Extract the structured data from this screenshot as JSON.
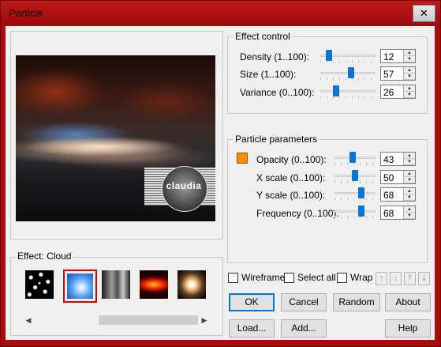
{
  "window": {
    "title": "Particle",
    "close_symbol": "✕"
  },
  "preview": {
    "watermark_text": "claudia"
  },
  "effect": {
    "label": "Effect: Cloud",
    "thumbnails": [
      "stars",
      "cloud",
      "smoke",
      "fire",
      "sparkle"
    ],
    "selected": "cloud"
  },
  "effect_control": {
    "title": "Effect control",
    "rows": [
      {
        "label": "Density (1..100):",
        "value": "12",
        "level": 0.12
      },
      {
        "label": "Size (1..100):",
        "value": "57",
        "level": 0.57
      },
      {
        "label": "Variance (0..100):",
        "value": "26",
        "level": 0.26
      }
    ]
  },
  "particle_parameters": {
    "title": "Particle parameters",
    "swatch_color": "#ff8c00",
    "rows": [
      {
        "label": "Opacity (0..100):",
        "value": "43",
        "level": 0.43
      },
      {
        "label": "X scale (0..100):",
        "value": "50",
        "level": 0.5
      },
      {
        "label": "Y scale (0..100):",
        "value": "68",
        "level": 0.68
      },
      {
        "label": "Frequency (0..100):",
        "value": "68",
        "level": 0.68
      }
    ]
  },
  "options": {
    "wireframe": "Wireframe",
    "select_all": "Select all",
    "wrap": "Wrap"
  },
  "arrow_icons": [
    "arrow-up-icon",
    "arrow-down-icon",
    "arrow-top-icon",
    "arrow-bottom-icon"
  ],
  "buttons": {
    "ok": "OK",
    "cancel": "Cancel",
    "random": "Random",
    "about": "About",
    "load": "Load...",
    "add": "Add...",
    "help": "Help"
  },
  "colors": {
    "title_bar": "#a80d0d",
    "accent": "#0078d7",
    "slider_knob": "#0a74d8"
  }
}
